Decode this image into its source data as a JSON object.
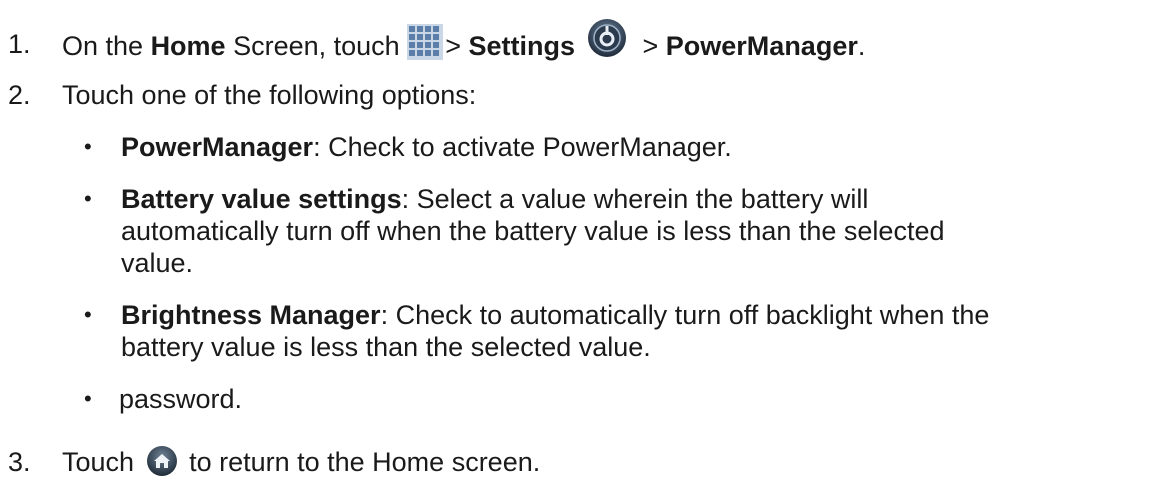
{
  "steps": [
    {
      "number": "1.",
      "text_before_home": "On the ",
      "home_bold": "Home",
      "text_after_home": " Screen, touch ",
      "apps_icon": "apps-grid-icon",
      "sep1": "> ",
      "settings_bold": "Settings",
      "settings_icon": "settings-gear-icon",
      "sep2": "> ",
      "powermanager_bold": "PowerManager",
      "period": "."
    },
    {
      "number": "2.",
      "text": "Touch one of the following options:"
    },
    {
      "number": "3.",
      "text_before_icon": "Touch ",
      "home_icon": "home-icon",
      "text_after_icon": " to return to the Home screen."
    }
  ],
  "options": [
    {
      "bullet": "•",
      "title": "PowerManager",
      "lines": [
        ": Check to activate PowerManager."
      ]
    },
    {
      "bullet": "•",
      "title": "Battery value settings",
      "lines": [
        ": Select a value wherein the battery will",
        "automatically turn off when the battery value is less than the selected",
        "value."
      ]
    },
    {
      "bullet": "•",
      "title": "Brightness Manager",
      "lines": [
        ": Check to automatically turn off backlight when the",
        "battery value is less than the selected value."
      ]
    },
    {
      "bullet": "•",
      "title": "",
      "lines": [
        "password."
      ]
    }
  ]
}
